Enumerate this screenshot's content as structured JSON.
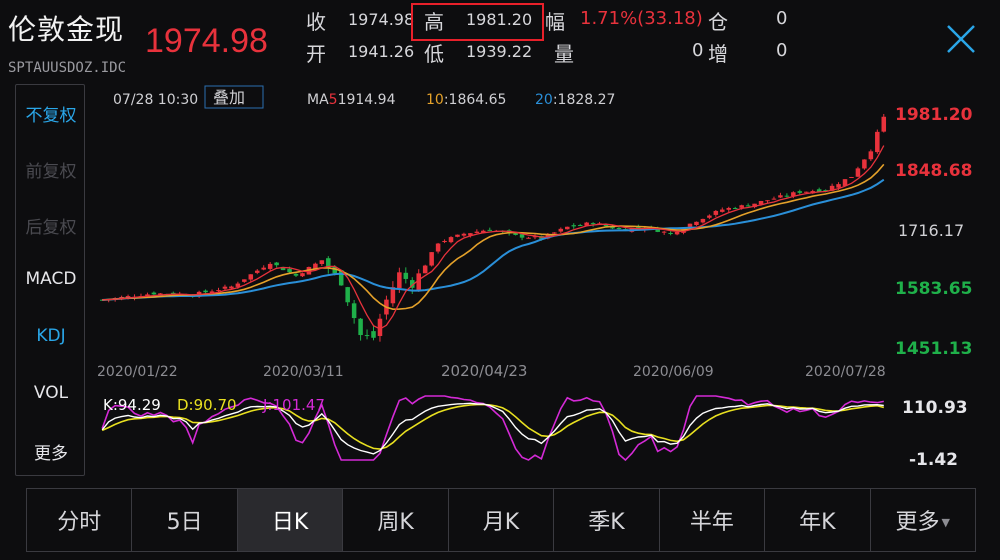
{
  "header": {
    "title": "伦敦金现",
    "symbol": "SPTAUUSDOZ.IDC",
    "price": "1974.98",
    "stats": {
      "close_label": "收",
      "close_value": "1974.98",
      "open_label": "开",
      "open_value": "1941.26",
      "high_label": "高",
      "high_value": "1981.20",
      "low_label": "低",
      "low_value": "1939.22",
      "change_label": "幅",
      "change_value": "1.71%(33.18)",
      "volume_label": "量",
      "volume_value": "0",
      "position_label": "仓",
      "position_value": "0",
      "increase_label": "增",
      "increase_value": "0"
    }
  },
  "side_menu": {
    "items": [
      {
        "label": "不复权",
        "state": "selected"
      },
      {
        "label": "前复权",
        "state": "disabled"
      },
      {
        "label": "后复权",
        "state": "disabled"
      },
      {
        "label": "MACD",
        "state": "normal"
      },
      {
        "label": "KDJ",
        "state": "selected"
      },
      {
        "label": "VOL",
        "state": "normal"
      },
      {
        "label": "更多",
        "state": "normal"
      }
    ]
  },
  "chart_header": {
    "datetime": "07/28 10:30",
    "overlay_button": "叠加",
    "ma5_label": "MA5:",
    "ma5_value": "1914.94",
    "ma10_label": "10:",
    "ma10_value": "1864.65",
    "ma20_label": "20:",
    "ma20_value": "1828.27"
  },
  "price_axis": [
    "1981.20",
    "1848.68",
    "1716.17",
    "1583.65",
    "1451.13"
  ],
  "date_axis": [
    "2020/01/22",
    "2020/03/11",
    "2020/04/23",
    "2020/06/09",
    "2020/07/28"
  ],
  "kdj": {
    "k_label": "K:94.29",
    "d_label": "D:90.70",
    "j_label": "J:101.47",
    "axis_top": "110.93",
    "axis_bottom": "-1.42"
  },
  "colors": {
    "up": "#e8323c",
    "down": "#1fb04a",
    "ma5": "#e8323c",
    "ma10": "#e4a12a",
    "ma20": "#2a8fd8",
    "k": "#ffffff",
    "d": "#e8e020",
    "j": "#d42ad6",
    "selected": "#2aa6e8"
  },
  "tabs": [
    {
      "label": "分时"
    },
    {
      "label": "5日"
    },
    {
      "label": "日K",
      "active": true
    },
    {
      "label": "周K"
    },
    {
      "label": "月K"
    },
    {
      "label": "季K"
    },
    {
      "label": "半年"
    },
    {
      "label": "年K"
    },
    {
      "label": "更多",
      "dropdown": true
    }
  ],
  "chart_data": {
    "type": "candlestick",
    "y_range": [
      1451.13,
      1981.2
    ],
    "x_range": [
      "2020/01/22",
      "2020/07/28"
    ],
    "close_anchors": [
      [
        0,
        1560
      ],
      [
        8,
        1575
      ],
      [
        14,
        1572
      ],
      [
        20,
        1590
      ],
      [
        26,
        1645
      ],
      [
        30,
        1615
      ],
      [
        34,
        1650
      ],
      [
        37,
        1600
      ],
      [
        40,
        1480
      ],
      [
        42,
        1475
      ],
      [
        44,
        1560
      ],
      [
        46,
        1620
      ],
      [
        48,
        1595
      ],
      [
        50,
        1640
      ],
      [
        52,
        1690
      ],
      [
        56,
        1710
      ],
      [
        60,
        1720
      ],
      [
        64,
        1705
      ],
      [
        68,
        1700
      ],
      [
        72,
        1725
      ],
      [
        76,
        1735
      ],
      [
        80,
        1720
      ],
      [
        84,
        1725
      ],
      [
        88,
        1710
      ],
      [
        92,
        1740
      ],
      [
        96,
        1765
      ],
      [
        100,
        1775
      ],
      [
        104,
        1790
      ],
      [
        108,
        1805
      ],
      [
        112,
        1810
      ],
      [
        116,
        1840
      ],
      [
        119,
        1900
      ],
      [
        121,
        1974.98
      ]
    ],
    "kdj_range": [
      -1.42,
      110.93
    ],
    "k_last": 94.29,
    "d_last": 90.7,
    "j_last": 101.47
  }
}
